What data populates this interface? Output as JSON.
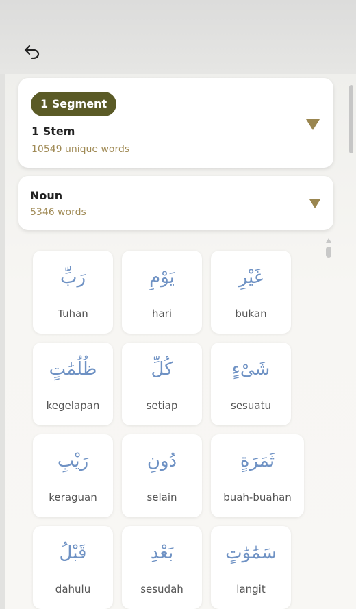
{
  "header": {
    "back_icon": "undo-arrow-icon"
  },
  "segment_card": {
    "badge": "1 Segment",
    "title": "1 Stem",
    "subtitle": "10549 unique words"
  },
  "noun_card": {
    "title": "Noun",
    "subtitle": "5346 words"
  },
  "colors": {
    "badge_bg": "#5a5a26",
    "arabic": "#6f92c4",
    "caret": "#9a8650"
  },
  "words": [
    {
      "arabic": "رَبِّ",
      "meaning": "Tuhan"
    },
    {
      "arabic": "يَوْمِ",
      "meaning": "hari"
    },
    {
      "arabic": "غَيْرِ",
      "meaning": "bukan"
    },
    {
      "arabic": "ظُلُمَٰتٍ",
      "meaning": "kegelapan"
    },
    {
      "arabic": "كُلِّ",
      "meaning": "setiap"
    },
    {
      "arabic": "شَىْءٍ",
      "meaning": "sesuatu"
    },
    {
      "arabic": "رَيْبِ",
      "meaning": "keraguan"
    },
    {
      "arabic": "دُونِ",
      "meaning": "selain"
    },
    {
      "arabic": "ثَمَرَةٍ",
      "meaning": "buah-buahan"
    },
    {
      "arabic": "قَبْلُ",
      "meaning": "dahulu"
    },
    {
      "arabic": "بَعْدِ",
      "meaning": "sesudah"
    },
    {
      "arabic": "سَمَٰوَٰتٍ",
      "meaning": "langit"
    }
  ]
}
